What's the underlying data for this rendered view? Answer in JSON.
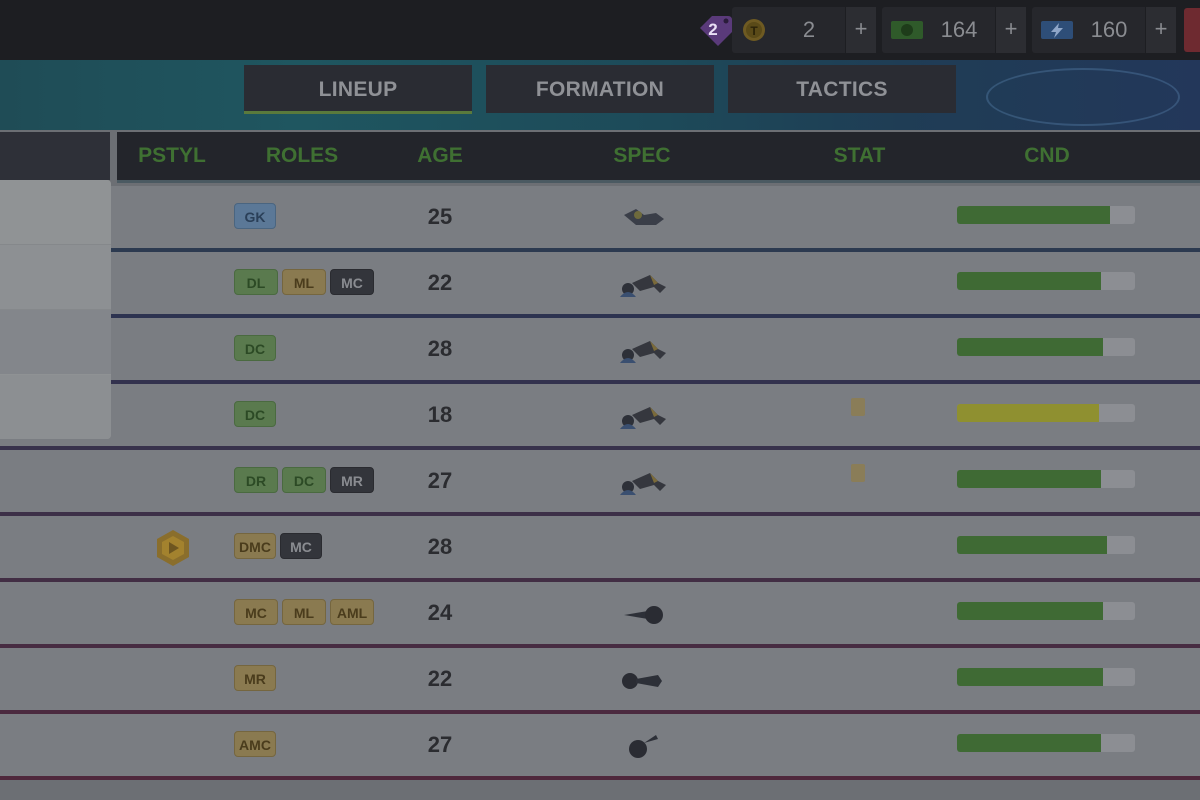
{
  "topbar": {
    "tag_count": "2",
    "resources": [
      {
        "name": "tokens",
        "icon": "token-coin-icon",
        "value": "2",
        "plus": "+"
      },
      {
        "name": "cash",
        "icon": "cash-icon",
        "value": "164",
        "plus": "+"
      },
      {
        "name": "energy",
        "icon": "energy-bolt-icon",
        "value": "160",
        "plus": "+"
      }
    ]
  },
  "tabs": [
    {
      "label": "LINEUP",
      "active": true
    },
    {
      "label": "FORMATION",
      "active": false
    },
    {
      "label": "TACTICS",
      "active": false
    }
  ],
  "columns": {
    "pstyl": "PSTYL",
    "roles": "ROLES",
    "age": "AGE",
    "spec": "SPEC",
    "stat": "STAT",
    "cnd": "CND"
  },
  "colors": {
    "role_gk": "#5b7897",
    "role_defender": "#5a7a4e",
    "role_midfield": "#8a7a50",
    "role_secondary": "#33353b",
    "condition_good": "#3f6a34",
    "condition_medium": "#8f9030"
  },
  "rows": [
    {
      "roles": [
        {
          "label": "GK",
          "kind": "blue"
        }
      ],
      "age": "25",
      "spec": "goalkeeper-glove-icon",
      "stat": false,
      "condition": 0.86,
      "cnd_color": "good",
      "sep": "#2c3a50"
    },
    {
      "roles": [
        {
          "label": "DL",
          "kind": "green"
        },
        {
          "label": "ML",
          "kind": "gold"
        },
        {
          "label": "MC",
          "kind": "dark"
        }
      ],
      "age": "22",
      "spec": "tackle-icon",
      "stat": false,
      "condition": 0.81,
      "cnd_color": "good",
      "sep": "#2d3350"
    },
    {
      "roles": [
        {
          "label": "DC",
          "kind": "green"
        }
      ],
      "age": "28",
      "spec": "tackle-icon",
      "stat": false,
      "condition": 0.82,
      "cnd_color": "good",
      "sep": "#33324e"
    },
    {
      "roles": [
        {
          "label": "DC",
          "kind": "green"
        }
      ],
      "age": "18",
      "spec": "tackle-icon",
      "stat": true,
      "condition": 0.8,
      "cnd_color": "medium",
      "sep": "#38324c"
    },
    {
      "roles": [
        {
          "label": "DR",
          "kind": "green"
        },
        {
          "label": "DC",
          "kind": "green"
        },
        {
          "label": "MR",
          "kind": "dark"
        }
      ],
      "age": "27",
      "spec": "tackle-icon",
      "stat": true,
      "condition": 0.81,
      "cnd_color": "good",
      "sep": "#3d3048"
    },
    {
      "roles": [
        {
          "label": "DMC",
          "kind": "gold"
        },
        {
          "label": "MC",
          "kind": "dark"
        }
      ],
      "age": "28",
      "spec": "",
      "stat": false,
      "condition": 0.84,
      "cnd_color": "good",
      "pstyl": "playmaker-badge-icon",
      "sep": "#422e44"
    },
    {
      "roles": [
        {
          "label": "MC",
          "kind": "gold"
        },
        {
          "label": "ML",
          "kind": "gold"
        },
        {
          "label": "AML",
          "kind": "gold"
        }
      ],
      "age": "24",
      "spec": "shooting-icon",
      "stat": false,
      "condition": 0.82,
      "cnd_color": "good",
      "sep": "#472c42"
    },
    {
      "roles": [
        {
          "label": "MR",
          "kind": "gold"
        }
      ],
      "age": "22",
      "spec": "dribbling-icon",
      "stat": false,
      "condition": 0.82,
      "cnd_color": "good",
      "sep": "#4b2a3f"
    },
    {
      "roles": [
        {
          "label": "AMC",
          "kind": "gold"
        }
      ],
      "age": "27",
      "spec": "ball-flight-icon",
      "stat": false,
      "condition": 0.81,
      "cnd_color": "good",
      "sep": "#4f283c"
    }
  ]
}
